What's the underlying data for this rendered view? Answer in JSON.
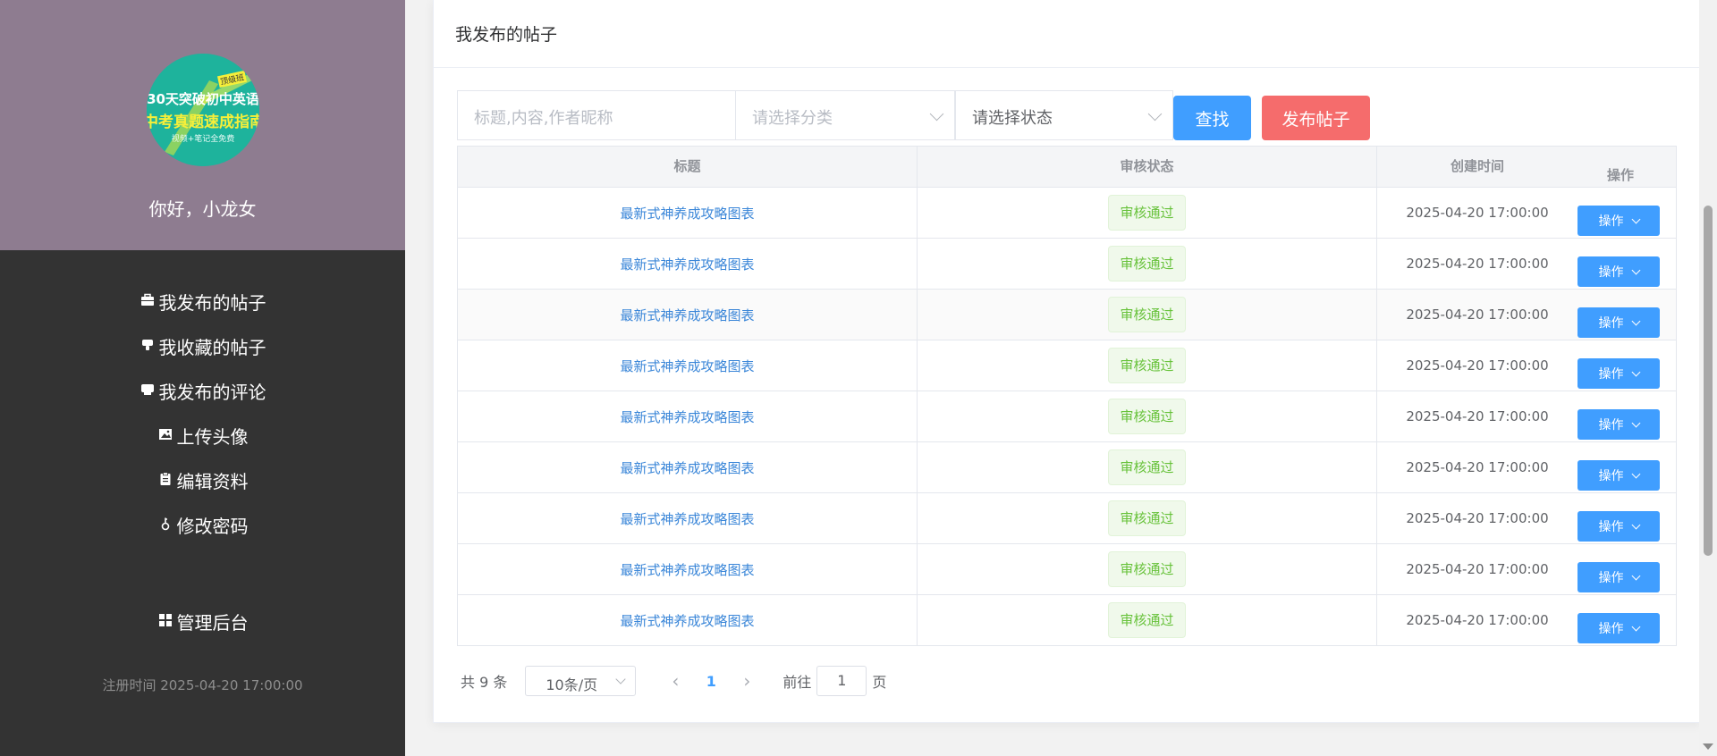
{
  "sidebar": {
    "avatar": {
      "line1": "30天突破初中英语",
      "line2": "中考真题速成指南",
      "line3": "视频+笔记全免费",
      "badge": "顶级班"
    },
    "greeting": "你好，小龙女",
    "menu": [
      {
        "icon": "briefcase-icon",
        "label": "我发布的帖子"
      },
      {
        "icon": "thumbs-down-icon",
        "label": "我收藏的帖子"
      },
      {
        "icon": "chat-icon",
        "label": "我发布的评论"
      },
      {
        "icon": "image-icon",
        "label": "上传头像"
      },
      {
        "icon": "clipboard-icon",
        "label": "编辑资料"
      },
      {
        "icon": "key-icon",
        "label": "修改密码"
      }
    ],
    "admin": {
      "icon": "grid-icon",
      "label": "管理后台"
    },
    "reg_time": "注册时间 2025-04-20 17:00:00"
  },
  "card": {
    "title": "我发布的帖子",
    "filters": {
      "keyword_placeholder": "标题,内容,作者昵称",
      "category_placeholder": "请选择分类",
      "status_value": "请选择状态",
      "search_label": "查找",
      "publish_label": "发布帖子"
    },
    "table": {
      "columns": [
        "标题",
        "审核状态",
        "创建时间",
        "操作"
      ],
      "rows": [
        {
          "title": "最新式神养成攻略图表",
          "status": "审核通过",
          "created": "2025-04-20 17:00:00",
          "action": "操作"
        },
        {
          "title": "最新式神养成攻略图表",
          "status": "审核通过",
          "created": "2025-04-20 17:00:00",
          "action": "操作"
        },
        {
          "title": "最新式神养成攻略图表",
          "status": "审核通过",
          "created": "2025-04-20 17:00:00",
          "action": "操作"
        },
        {
          "title": "最新式神养成攻略图表",
          "status": "审核通过",
          "created": "2025-04-20 17:00:00",
          "action": "操作"
        },
        {
          "title": "最新式神养成攻略图表",
          "status": "审核通过",
          "created": "2025-04-20 17:00:00",
          "action": "操作"
        },
        {
          "title": "最新式神养成攻略图表",
          "status": "审核通过",
          "created": "2025-04-20 17:00:00",
          "action": "操作"
        },
        {
          "title": "最新式神养成攻略图表",
          "status": "审核通过",
          "created": "2025-04-20 17:00:00",
          "action": "操作"
        },
        {
          "title": "最新式神养成攻略图表",
          "status": "审核通过",
          "created": "2025-04-20 17:00:00",
          "action": "操作"
        },
        {
          "title": "最新式神养成攻略图表",
          "status": "审核通过",
          "created": "2025-04-20 17:00:00",
          "action": "操作"
        }
      ]
    },
    "pagination": {
      "total": "共 9 条",
      "page_size": "10条/页",
      "prev": "‹",
      "current": "1",
      "next": "›",
      "goto_prefix": "前往",
      "goto_value": "1",
      "goto_suffix": "页"
    }
  },
  "colors": {
    "sidebar_bg": "#333333",
    "profile_bg": "#8e7c90",
    "primary": "#409eff",
    "danger": "#f56c6c",
    "success": "#67c23a"
  }
}
